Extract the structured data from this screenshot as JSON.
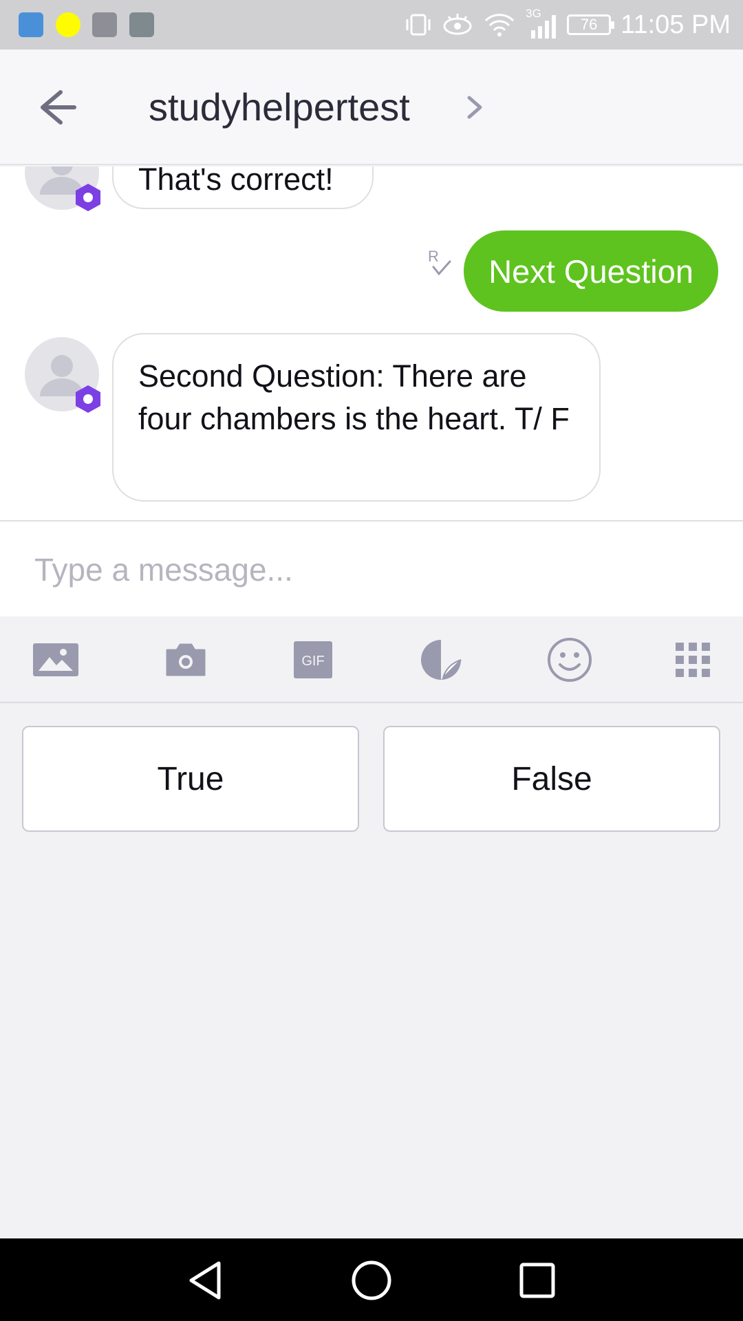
{
  "status_bar": {
    "network_label": "3G",
    "battery_level": "76",
    "time": "11:05 PM"
  },
  "header": {
    "title": "studyhelpertest"
  },
  "messages": [
    {
      "sender": "bot",
      "text": "That's correct!"
    },
    {
      "sender": "user",
      "text": "Next Question",
      "receipt": "R"
    },
    {
      "sender": "bot",
      "text": "Second Question: There are four chambers is the heart. T/ F"
    }
  ],
  "composer": {
    "placeholder": "Type a message...",
    "value": ""
  },
  "toolbar": {
    "items": [
      "image-icon",
      "camera-icon",
      "gif-icon",
      "sticker-icon",
      "emoji-icon",
      "apps-grid-icon"
    ],
    "gif_label": "GIF"
  },
  "quick_replies": [
    "True",
    "False"
  ],
  "colors": {
    "accent_green": "#5ec31e",
    "bot_badge_purple": "#7b3fe4",
    "icon_gray": "#9a9aae"
  }
}
